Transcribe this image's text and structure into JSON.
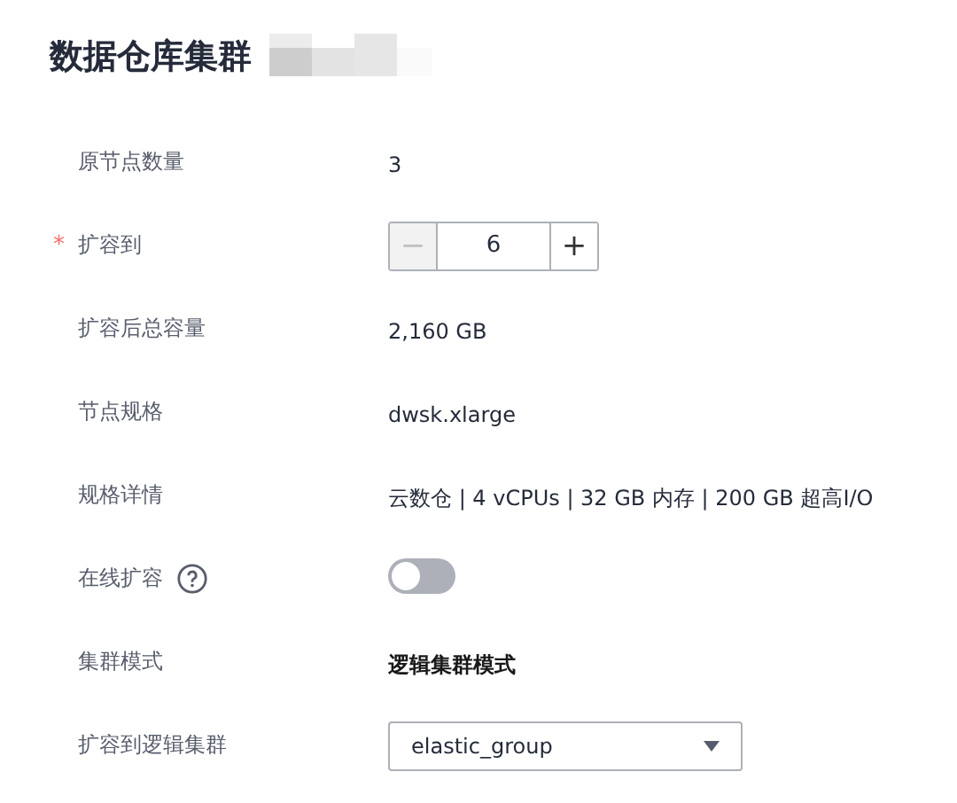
{
  "title": "数据仓库集群",
  "rows": [
    {
      "kind": "text",
      "label": "原节点数量",
      "value": "3"
    },
    {
      "kind": "stepper",
      "label": "扩容到",
      "required_mark": "*",
      "minus": "−",
      "value": "6",
      "plus": "+",
      "minus_disabled": true
    },
    {
      "kind": "text",
      "label": "扩容后总容量",
      "value": "2,160 GB"
    },
    {
      "kind": "text",
      "label": "节点规格",
      "value": "dwsk.xlarge"
    },
    {
      "kind": "text",
      "label": "规格详情",
      "value": "云数仓 | 4 vCPUs | 32 GB 内存 | 200 GB 超高I/O"
    },
    {
      "kind": "switch",
      "label": "在线扩容",
      "help": true,
      "on": false
    },
    {
      "kind": "strong",
      "label": "集群模式",
      "value": "逻辑集群模式"
    },
    {
      "kind": "select",
      "label": "扩容到逻辑集群",
      "value": "elastic_group"
    }
  ]
}
